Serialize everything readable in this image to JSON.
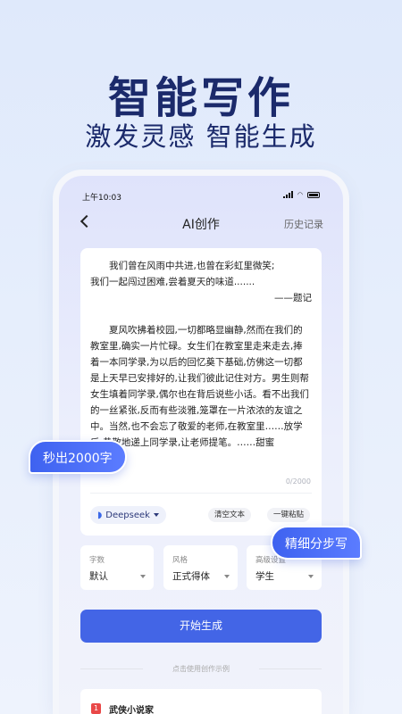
{
  "promo": {
    "headline": "智能写作",
    "subline": "激发灵感 智能生成"
  },
  "status_bar": {
    "time": "上午10:03"
  },
  "nav": {
    "title": "AI创作",
    "history": "历史记录"
  },
  "editor": {
    "poem_line1": "我们曾在风雨中共进,也曾在彩虹里微笑;",
    "poem_line2": "我们一起闯过困难,尝着夏天的味道.......",
    "signature": "——题记",
    "body": "夏风吹拂着校园,一切都略显幽静,然而在我们的教室里,确实一片忙碌。女生们在教室里走来走去,捧着一本同学录,为以后的回忆奠下基础,仿佛这一切都是上天早已安排好的,让我们彼此记住对方。男生则帮女生填着同学录,偶尔也在背后说些小话。看不出我们的一丝紧张,反而有些淡雅,笼罩在一片浓浓的友谊之中。当然,也不会忘了敬爱的老师,在教室里……放学后,恭敬地递上同学录,让老师提笔。……甜蜜",
    "char_count": "0/2000"
  },
  "tools": {
    "model": "Deepseek",
    "clear": "清空文本",
    "paste": "一键粘贴"
  },
  "selects": [
    {
      "label": "字数",
      "value": "默认"
    },
    {
      "label": "风格",
      "value": "正式得体"
    },
    {
      "label": "高级设置",
      "value": "学生"
    }
  ],
  "generate_label": "开始生成",
  "examples_hint": "点击使用创作示例",
  "example": {
    "rank": "1",
    "title": "武侠小说家"
  },
  "bubbles": {
    "left": "秒出2000字",
    "right": "精细分步写"
  },
  "colors": {
    "primary": "#4365e6",
    "headline": "#1b2a6b",
    "rank_badge": "#e94848"
  }
}
